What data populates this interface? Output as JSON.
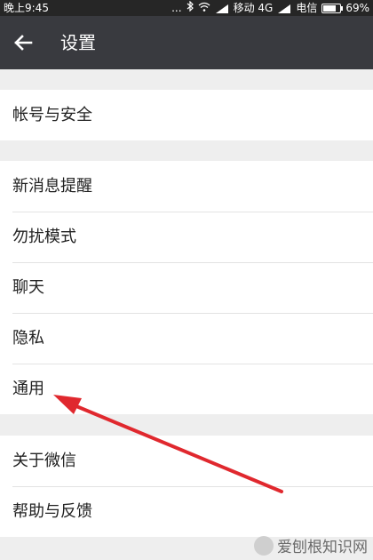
{
  "status_bar": {
    "time": "晚上9:45",
    "dots": "...",
    "carrier1": "移动 4G",
    "carrier2": "电信",
    "battery": "69%"
  },
  "header": {
    "title": "设置",
    "back_icon": "back-arrow-icon"
  },
  "groups": [
    {
      "items": [
        "帐号与安全"
      ]
    },
    {
      "items": [
        "新消息提醒",
        "勿扰模式",
        "聊天",
        "隐私",
        "通用"
      ]
    },
    {
      "items": [
        "关于微信",
        "帮助与反馈"
      ]
    }
  ],
  "watermark": {
    "text": "爱刨根知识网"
  },
  "colors": {
    "status_bar": "#262626",
    "title_bar": "#393a3f",
    "background": "#eeeeee",
    "annotation_arrow": "#e0282e"
  }
}
